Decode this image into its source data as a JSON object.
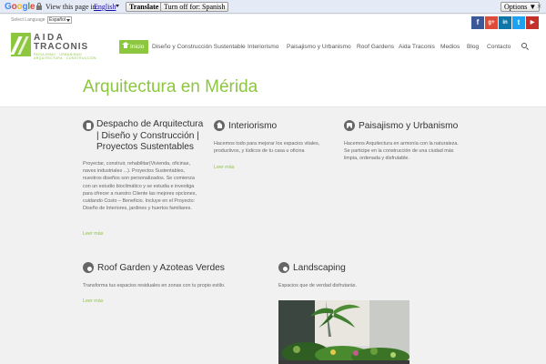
{
  "translate_bar": {
    "logo_letters": [
      "G",
      "o",
      "o",
      "g",
      "l",
      "e"
    ],
    "prompt": "View this page in:",
    "language": "English",
    "translate_label": "Translate",
    "turnoff_label": "Turn off for: Spanish",
    "options_label": "Options ▼",
    "close_label": "×"
  },
  "header": {
    "lang_label": "Select Language",
    "lang_value": "Español",
    "social": [
      {
        "name": "facebook",
        "glyph": "f",
        "color": "#3b5998"
      },
      {
        "name": "google-plus",
        "glyph": "g+",
        "color": "#dd4b39"
      },
      {
        "name": "linkedin",
        "glyph": "in",
        "color": "#0e76a8"
      },
      {
        "name": "twitter",
        "glyph": "t",
        "color": "#1da1f2"
      },
      {
        "name": "youtube",
        "glyph": "▶",
        "color": "#c4302b"
      }
    ],
    "logo": {
      "line1": "AIDA",
      "line2": "TRACONIS",
      "tag1": "PAISAJISMO · URBANISMO",
      "tag2": "ARQUITECTURA · CONSTRUCCIÓN"
    },
    "nav": [
      {
        "label": "Inicio",
        "active": true
      },
      {
        "label": "Diseño y Construcción Sustentable",
        "active": false
      },
      {
        "label": "Interiorismo",
        "active": false
      },
      {
        "label": "Paisajismo y Urbanismo",
        "active": false
      },
      {
        "label": "Roof Gardens",
        "active": false
      },
      {
        "label": "Aida Traconis",
        "active": false
      },
      {
        "label": "Medios",
        "active": false
      },
      {
        "label": "Blog",
        "active": false
      },
      {
        "label": "Contacto",
        "active": false
      }
    ]
  },
  "page": {
    "title": "Arquitectura en Mérida",
    "accent_color": "#8dc63f"
  },
  "services": [
    {
      "icon": "document-icon",
      "title": "Despacho de Arquitectura | Diseño y Construcción | Proyectos Sustentables",
      "text": "Proyectar, construir, rehabilitar(Vivienda, oficinas, naves industriales ...). Proyectos Sustentables, nuestros diseños son personalizados. Se comienza con un estudio bioclimático y se estudia e investiga para ofrecer a nuestro Cliente las mejores opciones, cuidando Costo – Beneficio. Incluye en el Proyecto: Diseño de Interiores, jardines y huertos familiares.",
      "more": "Leer más"
    },
    {
      "icon": "home-icon",
      "title": "Interiorismo",
      "text": "Hacemos todo para mejorar los espacios vitales, productivos, y lúdicos de tu casa u oficina",
      "more": "Leer más"
    },
    {
      "icon": "picture-icon",
      "title": "Paisajismo y Urbanismo",
      "text": "Hacemos Arquitectura en armonía con la naturaleza. Se participe en la construcción de una ciudad más limpia, ordenada y disfrutable.",
      "more": ""
    },
    {
      "icon": "camera-icon",
      "title": "Roof Garden y Azoteas Verdes",
      "text": "Transforma tus espacios residuales en zonas con tu propio estilo.",
      "more": "Leer más"
    },
    {
      "icon": "camera-icon",
      "title": "Landscaping",
      "text": "Espacios que de verdad disfrutarás.",
      "more": ""
    }
  ]
}
